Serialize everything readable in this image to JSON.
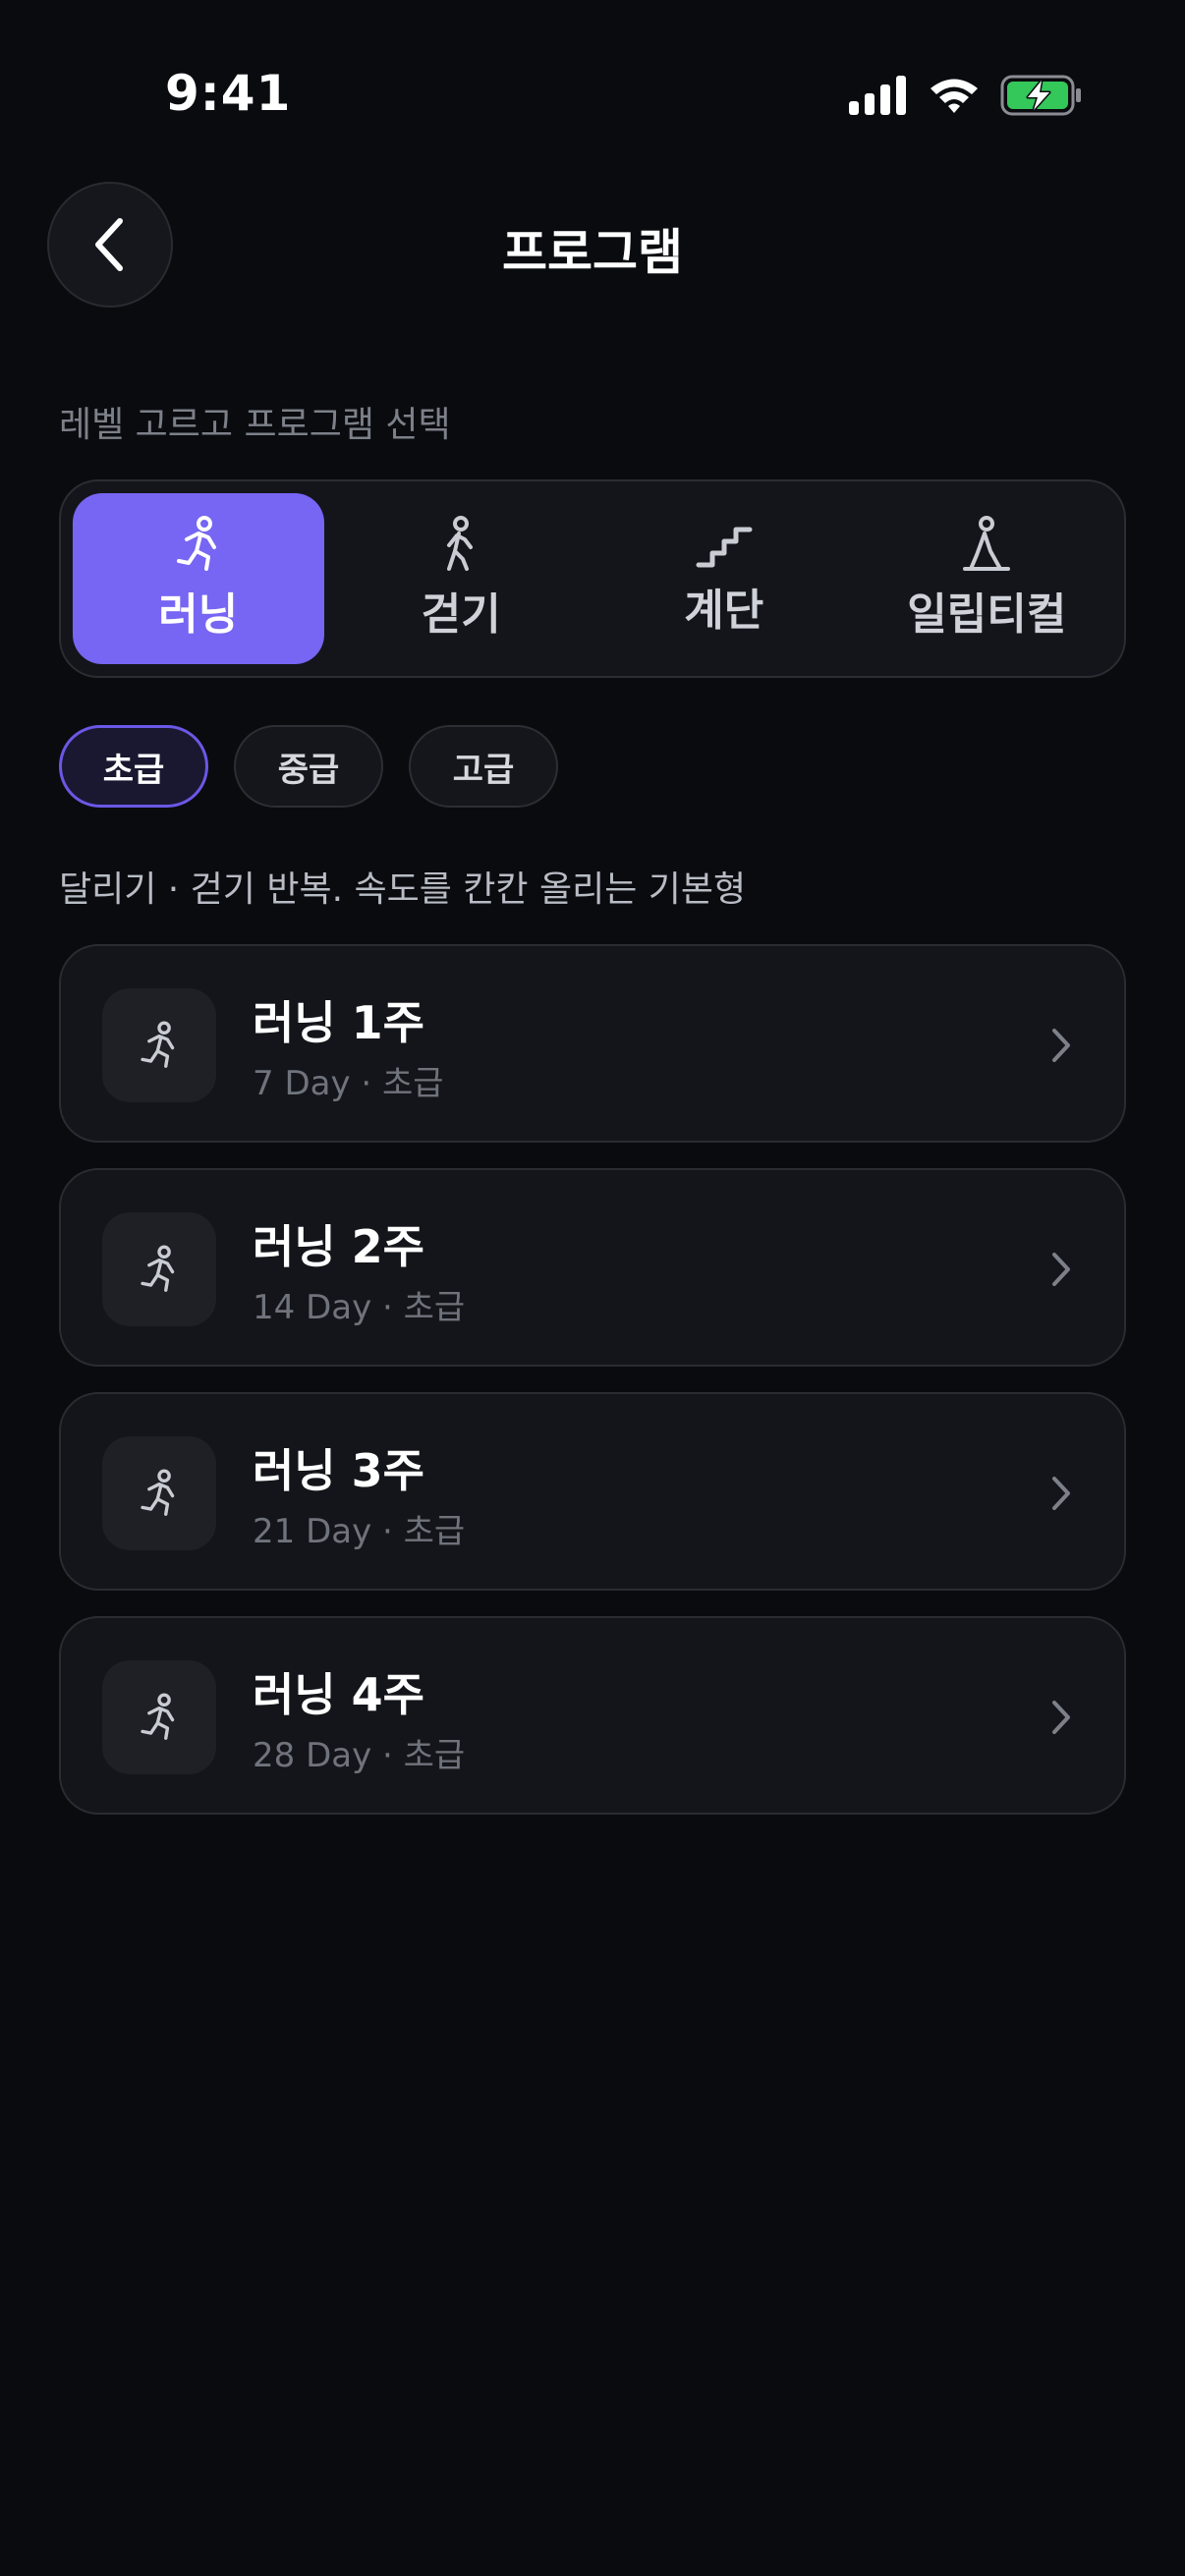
{
  "status_bar": {
    "time": "9:41"
  },
  "header": {
    "title": "프로그램"
  },
  "section_label": "레벨 고르고 프로그램 선택",
  "activity_tabs": [
    {
      "label": "러닝",
      "icon": "running-icon",
      "active": true
    },
    {
      "label": "걷기",
      "icon": "walking-icon",
      "active": false
    },
    {
      "label": "계단",
      "icon": "stairs-icon",
      "active": false
    },
    {
      "label": "일립티컬",
      "icon": "elliptical-icon",
      "active": false
    }
  ],
  "level_chips": [
    {
      "label": "초급",
      "active": true
    },
    {
      "label": "중급",
      "active": false
    },
    {
      "label": "고급",
      "active": false
    }
  ],
  "description": "달리기 · 걷기 반복. 속도를 칸칸 올리는 기본형",
  "programs": [
    {
      "title": "러닝 1주",
      "subtitle": "7 Day · 초급"
    },
    {
      "title": "러닝 2주",
      "subtitle": "14 Day · 초급"
    },
    {
      "title": "러닝 3주",
      "subtitle": "21 Day · 초급"
    },
    {
      "title": "러닝 4주",
      "subtitle": "28 Day · 초급"
    }
  ],
  "colors": {
    "background": "#0a0b0f",
    "accent": "#7765f3",
    "battery_green": "#34c759"
  }
}
